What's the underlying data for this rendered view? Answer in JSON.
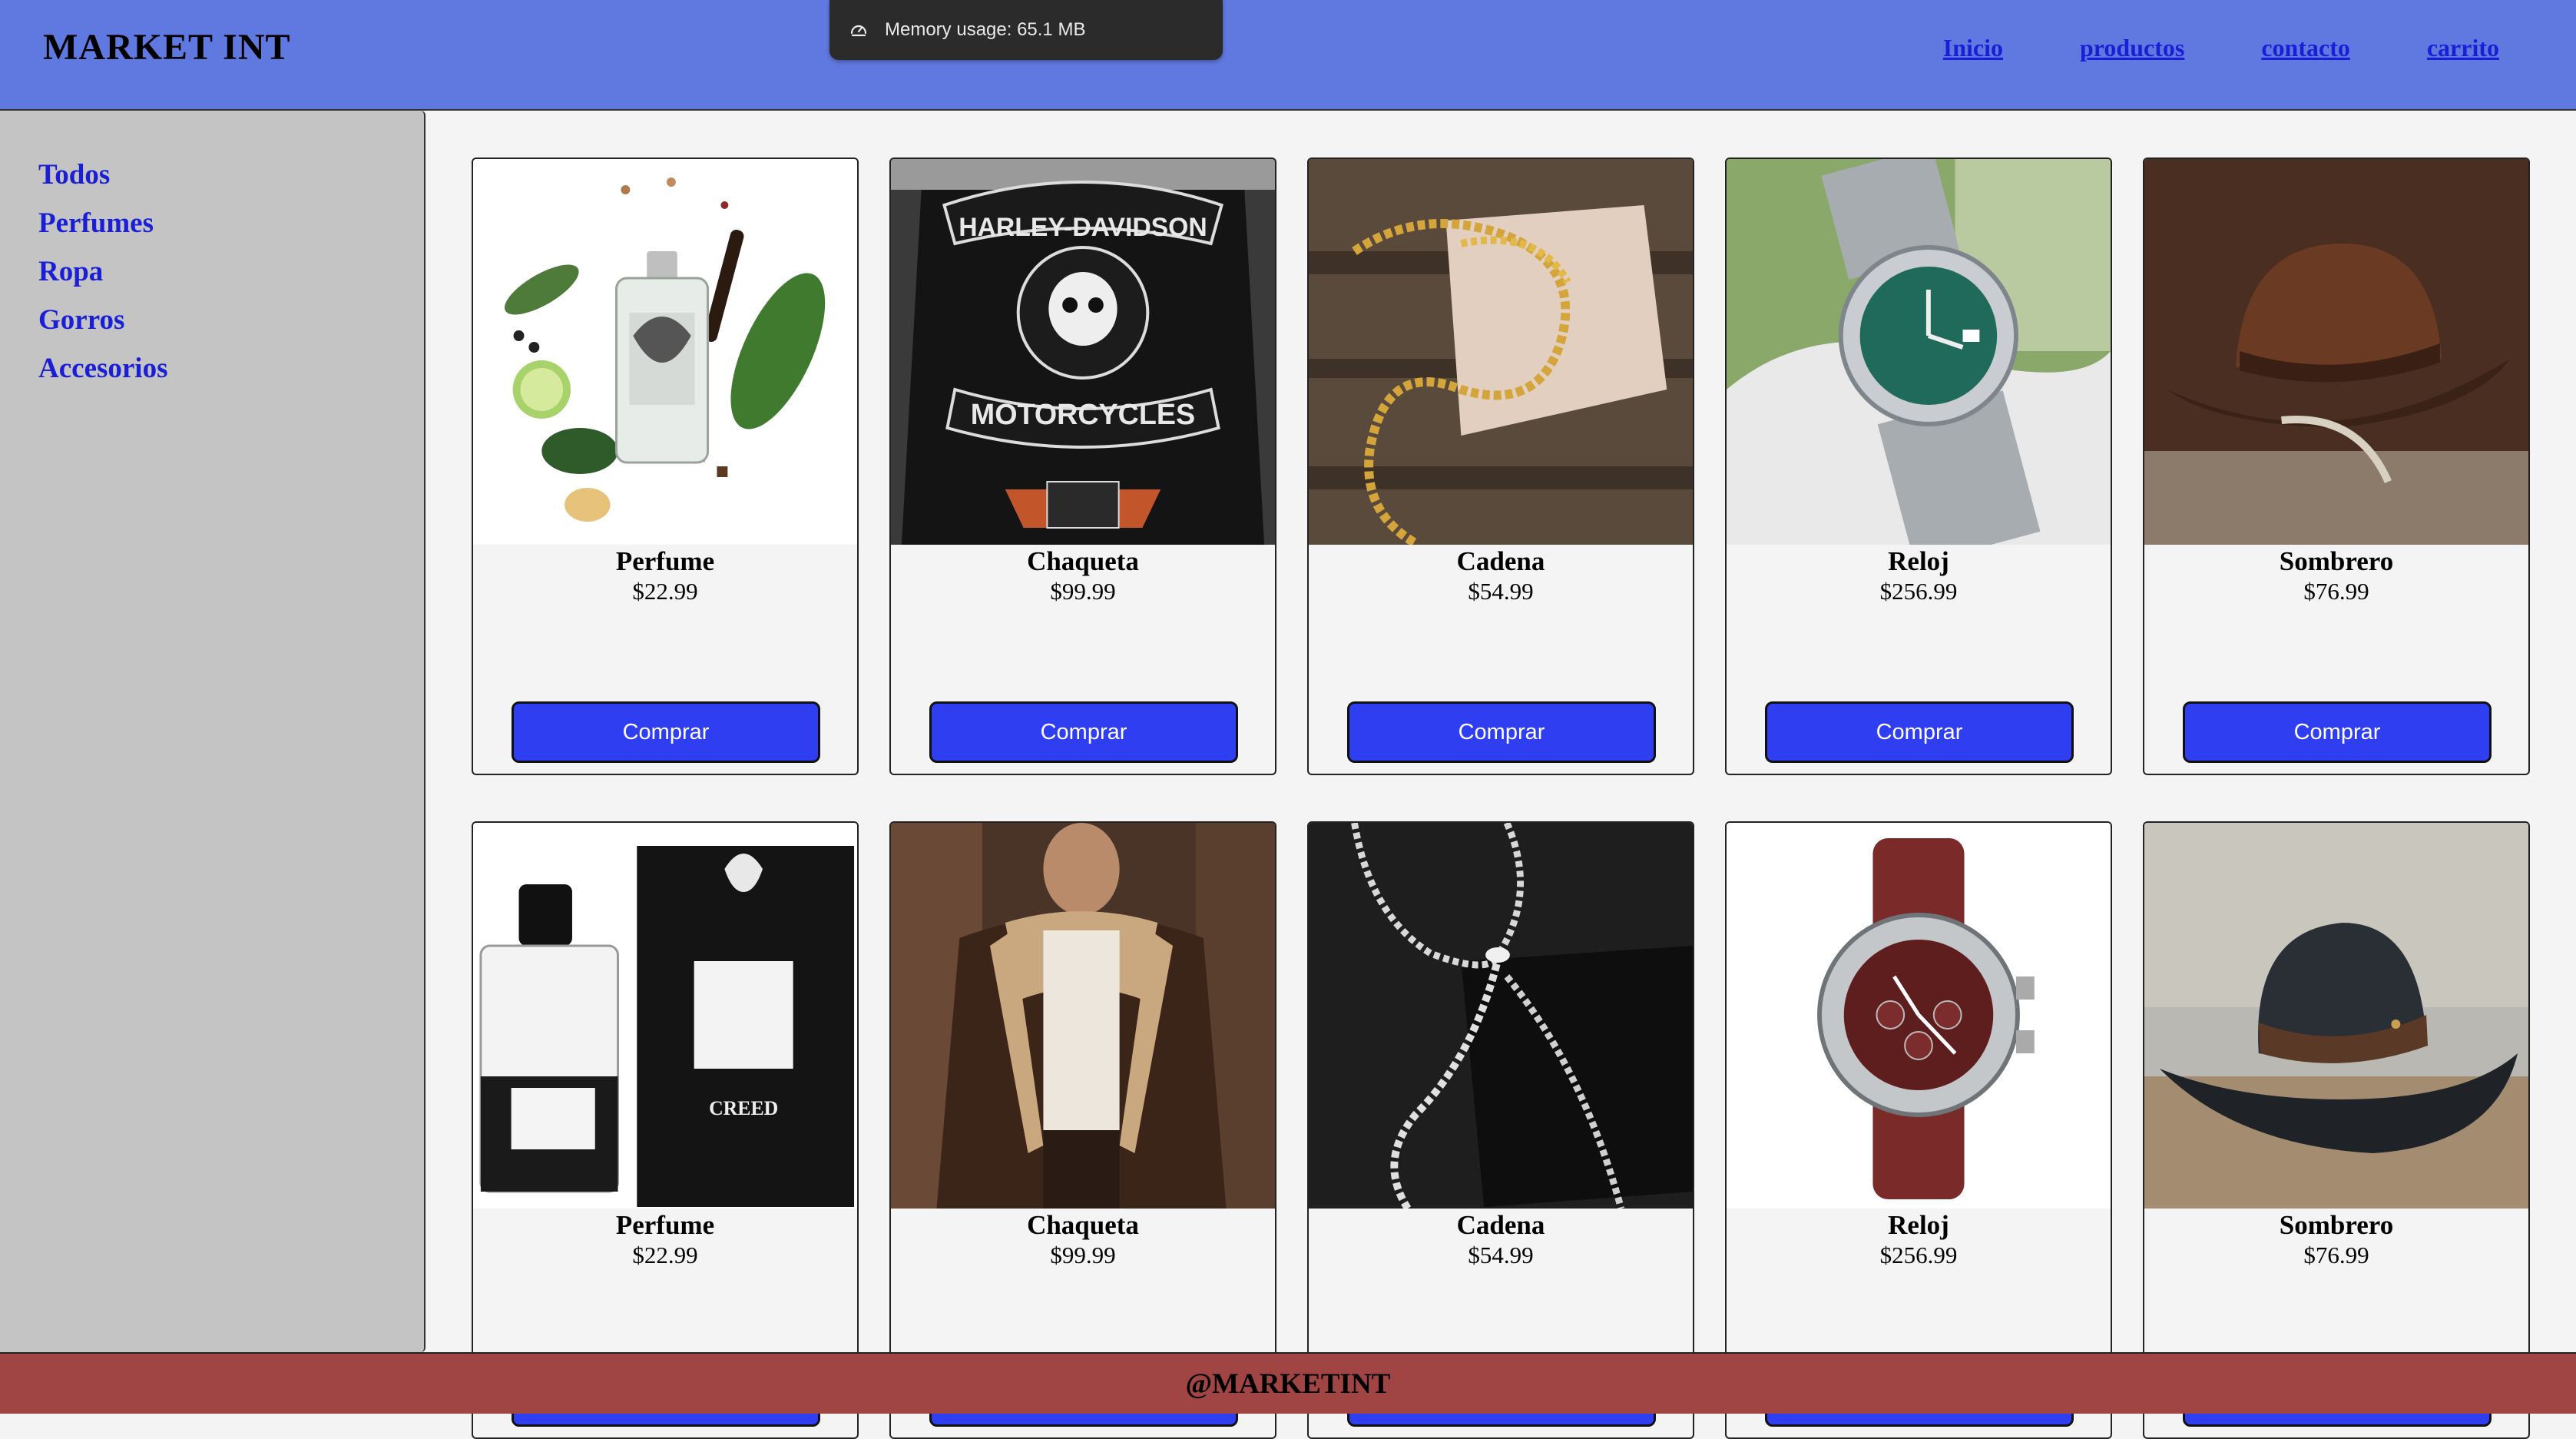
{
  "header": {
    "brand": "MARKET INT",
    "nav": [
      "Inicio",
      "productos",
      "contacto",
      "carrito"
    ]
  },
  "memory": {
    "icon": "gauge-icon",
    "text": "Memory usage: 65.1 MB"
  },
  "sidebar": {
    "categories": [
      "Todos",
      "Perfumes",
      "Ropa",
      "Gorros",
      "Accesorios"
    ]
  },
  "products": [
    {
      "name": "Perfume",
      "price": "$22.99",
      "button": "Comprar",
      "image": "perfume-bottle-with-ingredients"
    },
    {
      "name": "Chaqueta",
      "price": "$99.99",
      "button": "Comprar",
      "image": "harley-davidson-leather-jacket"
    },
    {
      "name": "Cadena",
      "price": "$54.99",
      "button": "Comprar",
      "image": "gold-rope-chain"
    },
    {
      "name": "Reloj",
      "price": "$256.99",
      "button": "Comprar",
      "image": "green-dial-watch"
    },
    {
      "name": "Sombrero",
      "price": "$76.99",
      "button": "Comprar",
      "image": "brown-leather-hat"
    },
    {
      "name": "Perfume",
      "price": "$22.99",
      "button": "Comprar",
      "image": "aventus-perfume-box"
    },
    {
      "name": "Chaqueta",
      "price": "$99.99",
      "button": "Comprar",
      "image": "shearling-aviator-jacket"
    },
    {
      "name": "Cadena",
      "price": "$54.99",
      "button": "Comprar",
      "image": "silver-rope-chain"
    },
    {
      "name": "Reloj",
      "price": "$256.99",
      "button": "Comprar",
      "image": "red-strap-chronograph-watch"
    },
    {
      "name": "Sombrero",
      "price": "$76.99",
      "button": "Comprar",
      "image": "dark-leather-cowboy-hat"
    }
  ],
  "footer": {
    "text": "@MARKETINT"
  },
  "colors": {
    "header_bg": "#6079e0",
    "sidebar_bg": "#c4c4c4",
    "link": "#1a1fd6",
    "button_bg": "#2f3ef0",
    "footer_bg": "#a04444"
  }
}
